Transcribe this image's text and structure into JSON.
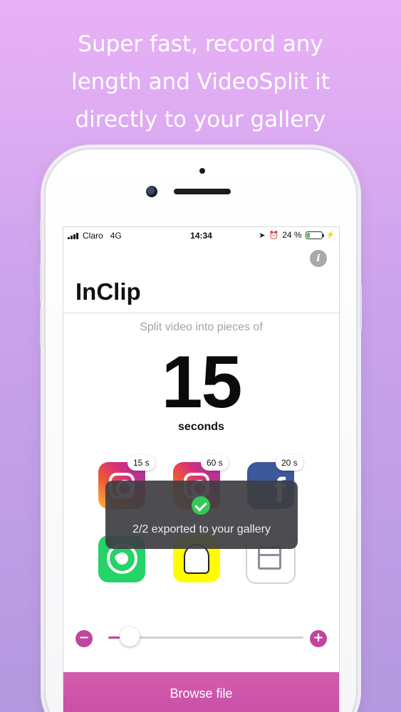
{
  "promo": {
    "headline": "Super fast, record any\nlength and VideoSplit it\ndirectly to your gallery"
  },
  "status_bar": {
    "carrier": "Claro",
    "network": "4G",
    "time": "14:34",
    "battery_percent": "24 %",
    "battery_level": 0.24
  },
  "app": {
    "title": "InClip",
    "info_icon": "i",
    "subtitle": "Split video into pieces of",
    "duration_value": "15",
    "duration_unit": "seconds"
  },
  "platforms": [
    {
      "name": "instagram-icon",
      "badge": "15 s"
    },
    {
      "name": "instagram-icon",
      "badge": "60 s"
    },
    {
      "name": "facebook-icon",
      "badge": "20 s",
      "glyph": "f"
    },
    {
      "name": "whatsapp-icon"
    },
    {
      "name": "snapchat-icon"
    },
    {
      "name": "document-icon"
    }
  ],
  "toast": {
    "message": "2/2 exported to your gallery"
  },
  "slider": {
    "minus_label": "−",
    "plus_label": "+",
    "value_fraction": 0.06
  },
  "browse_button": {
    "label": "Browse file"
  },
  "colors": {
    "accent": "#c74ea4",
    "success": "#34c759",
    "toast_bg": "#3e3e42"
  }
}
